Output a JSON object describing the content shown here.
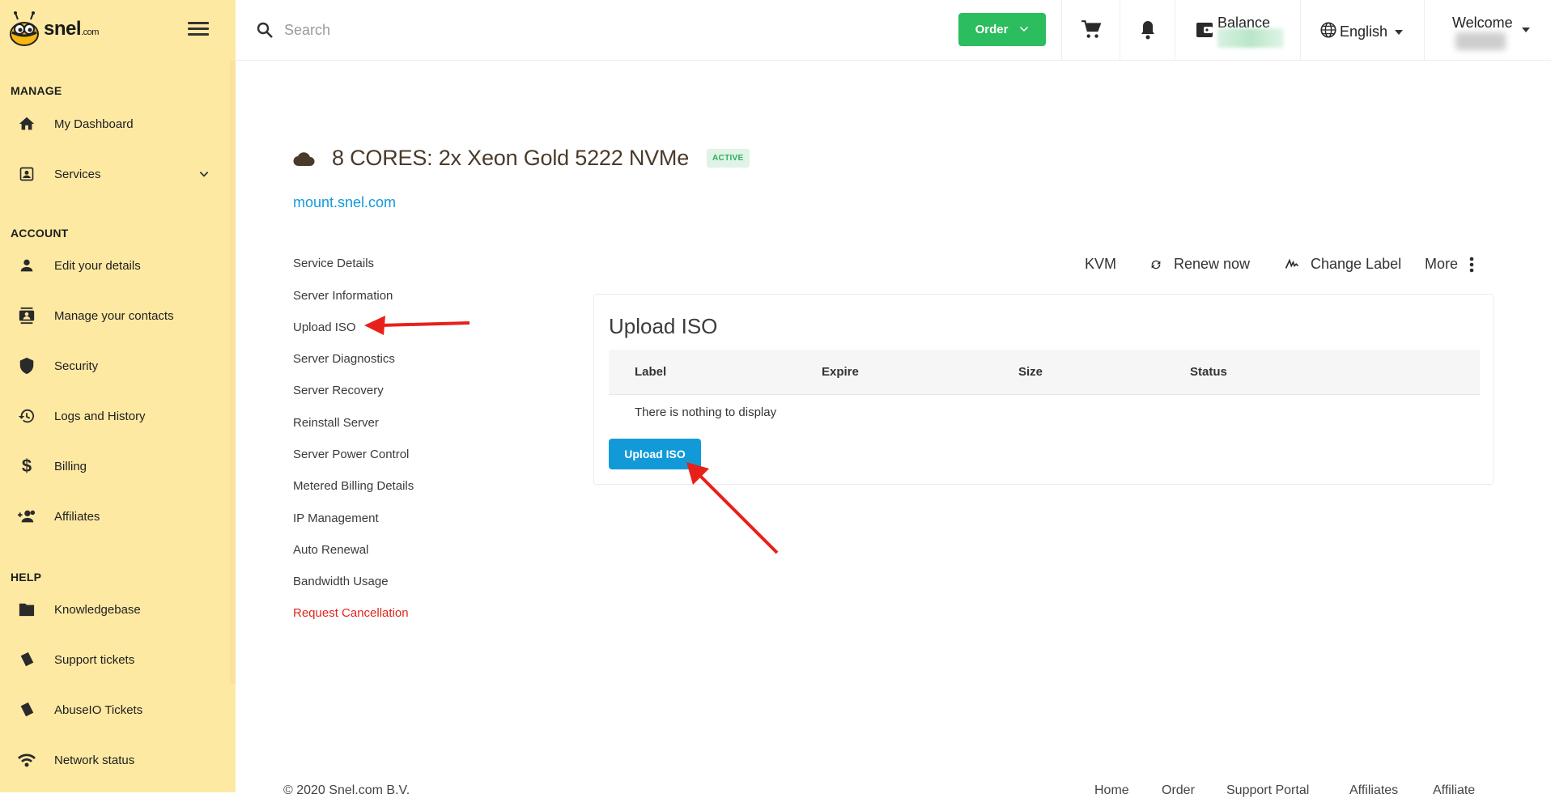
{
  "brand": {
    "name": "snel",
    "suffix": ".com"
  },
  "sidebar": {
    "sections": [
      {
        "title": "MANAGE",
        "items": [
          {
            "label": "My Dashboard",
            "icon": "home-icon"
          },
          {
            "label": "Services",
            "icon": "services-icon",
            "expandable": true
          }
        ]
      },
      {
        "title": "ACCOUNT",
        "items": [
          {
            "label": "Edit your details",
            "icon": "person-icon"
          },
          {
            "label": "Manage your contacts",
            "icon": "contacts-icon"
          },
          {
            "label": "Security",
            "icon": "shield-icon"
          },
          {
            "label": "Logs and History",
            "icon": "history-icon"
          },
          {
            "label": "Billing",
            "icon": "dollar-icon"
          },
          {
            "label": "Affiliates",
            "icon": "affiliates-icon"
          }
        ]
      },
      {
        "title": "HELP",
        "items": [
          {
            "label": "Knowledgebase",
            "icon": "folder-icon"
          },
          {
            "label": "Support tickets",
            "icon": "ticket-icon"
          },
          {
            "label": "AbuseIO Tickets",
            "icon": "ticket-icon"
          },
          {
            "label": "Network status",
            "icon": "wifi-icon"
          }
        ]
      }
    ]
  },
  "topbar": {
    "search_placeholder": "Search",
    "order_label": "Order",
    "balance_label": "Balance",
    "language": "English",
    "welcome_label": "Welcome"
  },
  "service": {
    "title": "8 CORES: 2x Xeon Gold 5222 NVMe",
    "status": "ACTIVE",
    "domain": "mount.snel.com"
  },
  "service_nav": [
    "Service Details",
    "Server Information",
    "Upload ISO",
    "Server Diagnostics",
    "Server Recovery",
    "Reinstall Server",
    "Server Power Control",
    "Metered Billing Details",
    "IP Management",
    "Auto Renewal",
    "Bandwidth Usage",
    "Request Cancellation"
  ],
  "actions": {
    "kvm": "KVM",
    "renew": "Renew now",
    "change_label": "Change Label",
    "more": "More"
  },
  "panel": {
    "title": "Upload ISO",
    "columns": [
      "Label",
      "Expire",
      "Size",
      "Status"
    ],
    "empty_text": "There is nothing to display",
    "button": "Upload ISO"
  },
  "footer": {
    "copyright": "© 2020 Snel.com B.V.",
    "links": [
      "Home",
      "Order",
      "Support Portal",
      "Affiliates",
      "Affiliate"
    ]
  },
  "colors": {
    "sidebar_bg": "#fee9a3",
    "accent_blue": "#129ad8",
    "order_green": "#2bbd5e",
    "danger": "#e0251b",
    "annotation_arrow": "#e8201a"
  }
}
